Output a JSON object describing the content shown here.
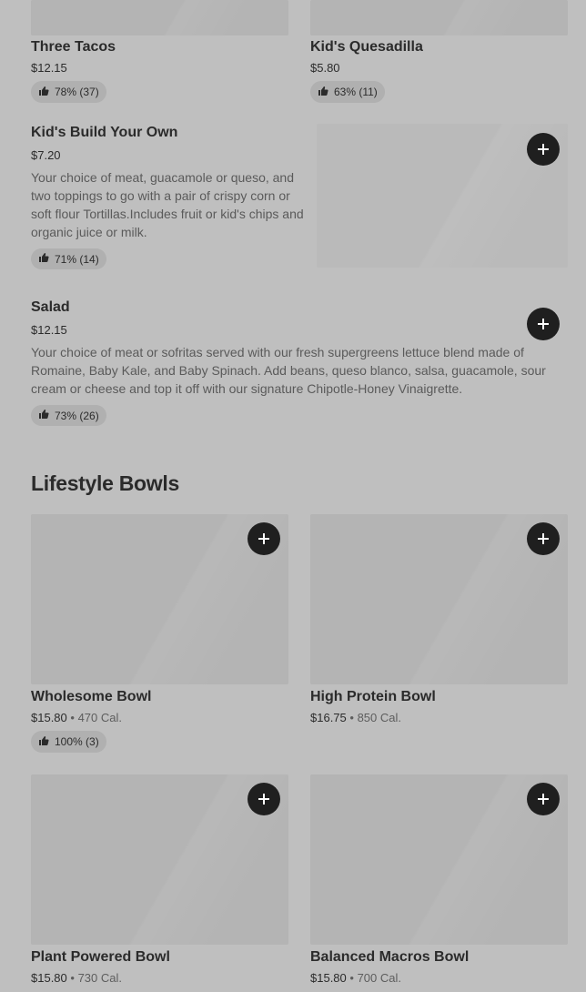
{
  "top_items": [
    {
      "name": "Three Tacos",
      "price": "$12.15",
      "rating": "78% (37)"
    },
    {
      "name": "Kid's Quesadilla",
      "price": "$5.80",
      "rating": "63% (11)"
    }
  ],
  "list_items": [
    {
      "name": "Kid's Build Your Own",
      "price": "$7.20",
      "description": "Your choice of meat, guacamole or queso, and two toppings to go with a pair of crispy corn or soft flour Tortillas.Includes fruit or kid's chips and organic juice or milk.",
      "rating": "71% (14)"
    },
    {
      "name": "Salad",
      "price": "$12.15",
      "description": "Your choice of meat or sofritas served with our fresh supergreens lettuce blend made of Romaine, Baby Kale, and Baby Spinach. Add beans, queso blanco, salsa, guacamole, sour cream or cheese and top it off with our signature Chipotle-Honey Vinaigrette.",
      "rating": "73% (26)"
    }
  ],
  "section": {
    "title": "Lifestyle Bowls"
  },
  "bowls": [
    {
      "name": "Wholesome Bowl",
      "price": "$15.80",
      "separator": "•",
      "calories": "470 Cal.",
      "rating": "100% (3)"
    },
    {
      "name": "High Protein Bowl",
      "price": "$16.75",
      "separator": "•",
      "calories": "850 Cal."
    },
    {
      "name": "Plant Powered Bowl",
      "price": "$15.80",
      "separator": "•",
      "calories": "730 Cal."
    },
    {
      "name": "Balanced Macros Bowl",
      "price": "$15.80",
      "separator": "•",
      "calories": "700 Cal."
    }
  ],
  "icons": {
    "add": "plus-icon",
    "rating": "thumbs-up-icon"
  },
  "colors": {
    "background": "#bfbfbf",
    "button": "#1f1f1f",
    "placeholder": "#b4b4b4"
  }
}
